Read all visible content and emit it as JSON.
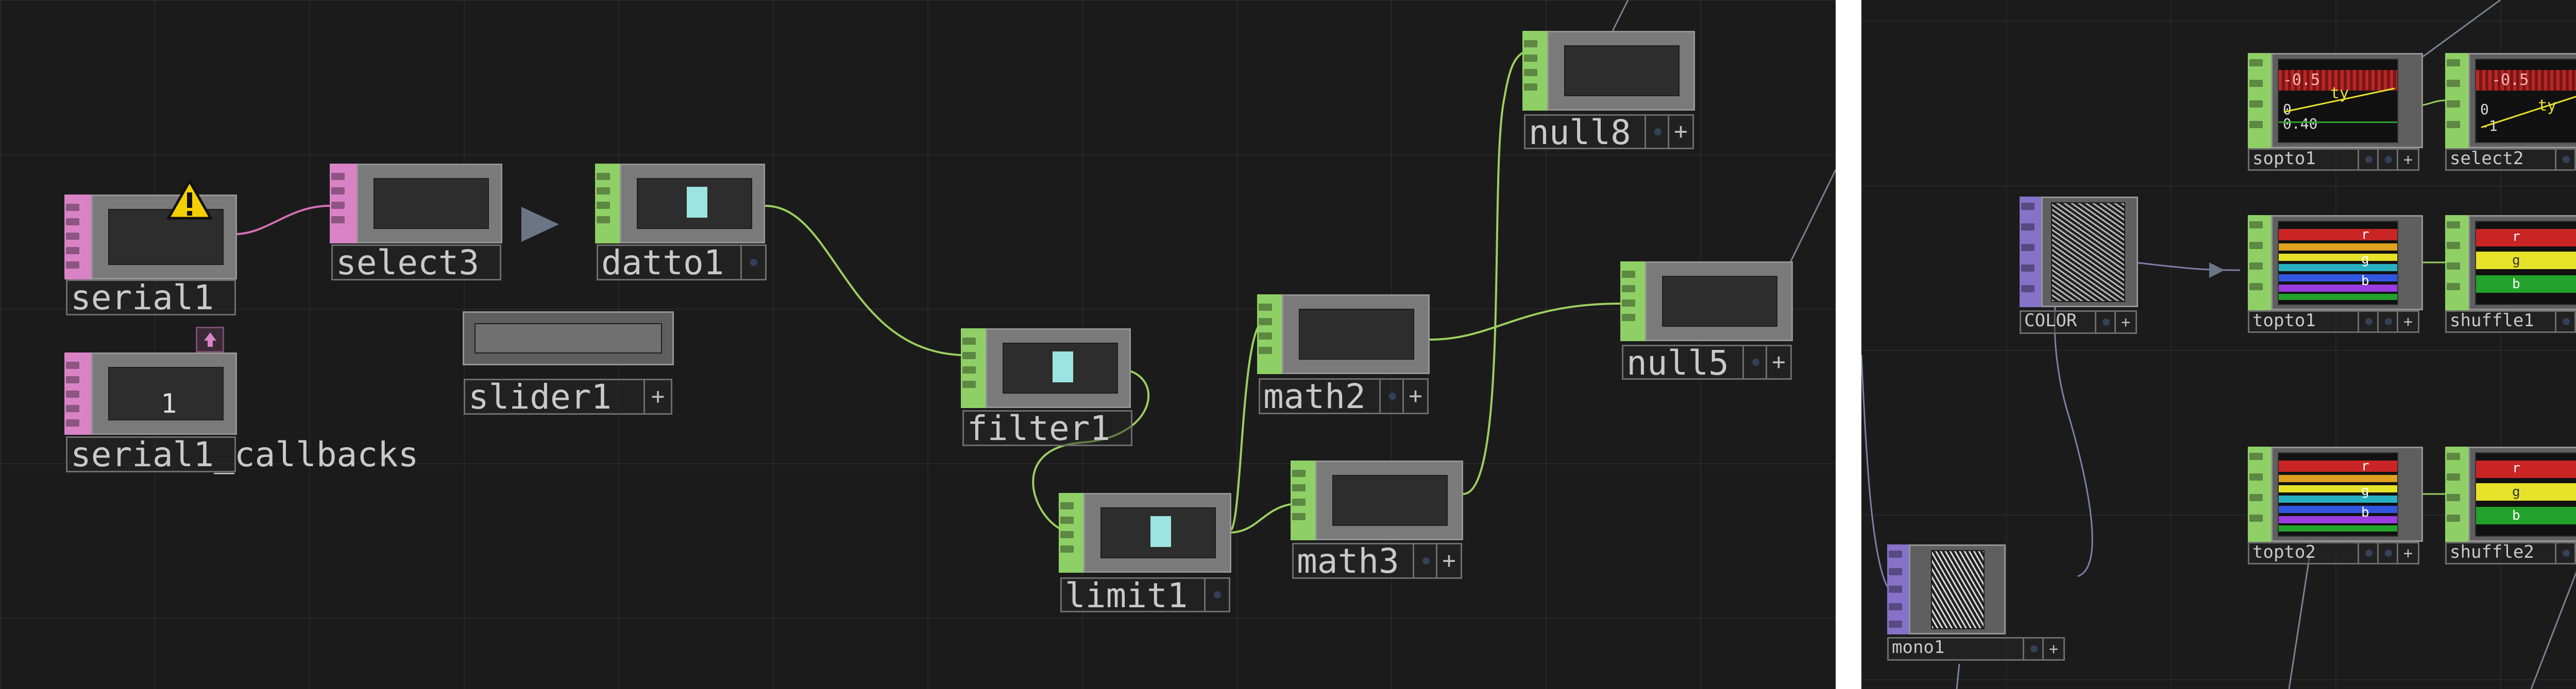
{
  "left_network": {
    "nodes": {
      "serial1": {
        "label": "serial1",
        "type": "DAT"
      },
      "serial1_callbacks": {
        "label": "serial1_callbacks",
        "value": "1",
        "type": "DAT"
      },
      "select3": {
        "label": "select3",
        "type": "DAT"
      },
      "slider1": {
        "label": "slider1",
        "type": "COMP"
      },
      "datto1": {
        "label": "datto1",
        "type": "CHOP"
      },
      "filter1": {
        "label": "filter1",
        "type": "CHOP"
      },
      "limit1": {
        "label": "limit1",
        "type": "CHOP"
      },
      "math2": {
        "label": "math2",
        "type": "CHOP"
      },
      "math3": {
        "label": "math3",
        "type": "CHOP"
      },
      "null8": {
        "label": "null8",
        "type": "CHOP"
      },
      "null5": {
        "label": "null5",
        "type": "CHOP"
      }
    },
    "plus_glyph": "+",
    "warning_icon": "warning-icon"
  },
  "right_network": {
    "nodes": {
      "COLOR": {
        "label": "COLOR",
        "type": "TOP"
      },
      "mono1": {
        "label": "mono1",
        "type": "TOP"
      },
      "sopto1": {
        "label": "sopto1",
        "type": "CHOP",
        "viewer_text": [
          "-0.5",
          "ty",
          "0",
          "0.40"
        ]
      },
      "select2": {
        "label": "select2",
        "type": "CHOP",
        "viewer_text": [
          "-0.5",
          "ty",
          "0",
          "-1"
        ]
      },
      "topto1": {
        "label": "topto1",
        "type": "CHOP",
        "viewer_text": [
          "r",
          "g",
          "b"
        ]
      },
      "shuffle1": {
        "label": "shuffle1",
        "type": "CHOP",
        "viewer_text": [
          "r",
          "g",
          "b"
        ]
      },
      "topto2": {
        "label": "topto2",
        "type": "CHOP",
        "viewer_text": [
          "r",
          "g",
          "b"
        ]
      },
      "shuffle2": {
        "label": "shuffle2",
        "type": "CHOP",
        "viewer_text": [
          "r",
          "g",
          "b"
        ]
      }
    },
    "plus_glyph": "+"
  },
  "colors": {
    "background": "#1b1b1b",
    "chop_family": "#8fd066",
    "dat_family": "#d983c6",
    "top_family": "#8672c8",
    "wire_chop": "#9ccf5f",
    "wire_dat": "#d66fb5",
    "wire_top": "#7c80aa",
    "warning": "#f5d000",
    "highlight": "#9de3e1"
  }
}
